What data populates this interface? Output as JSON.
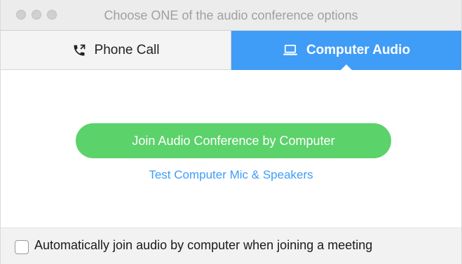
{
  "window": {
    "title": "Choose ONE of the audio conference options"
  },
  "tabs": [
    {
      "label": "Phone Call",
      "icon": "phone-icon",
      "selected": false
    },
    {
      "label": "Computer Audio",
      "icon": "laptop-icon",
      "selected": true
    }
  ],
  "content": {
    "join_button_label": "Join Audio Conference by Computer",
    "test_link_label": "Test Computer Mic & Speakers"
  },
  "footer": {
    "auto_join_label": "Automatically join audio by computer when joining a meeting",
    "auto_join_checked": false
  },
  "colors": {
    "accent_blue": "#3f9cf7",
    "join_green": "#5bd26a"
  }
}
